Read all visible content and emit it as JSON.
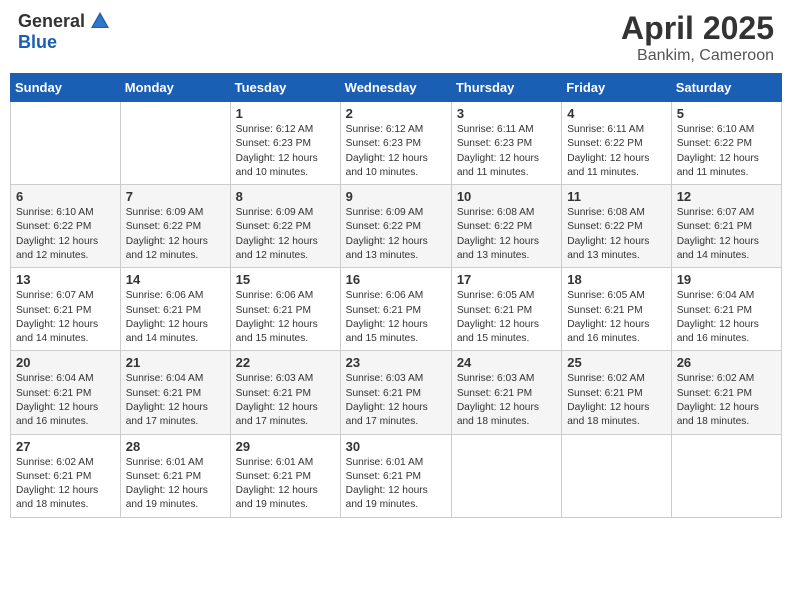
{
  "header": {
    "logo_general": "General",
    "logo_blue": "Blue",
    "month": "April 2025",
    "location": "Bankim, Cameroon"
  },
  "weekdays": [
    "Sunday",
    "Monday",
    "Tuesday",
    "Wednesday",
    "Thursday",
    "Friday",
    "Saturday"
  ],
  "weeks": [
    [
      {
        "day": "",
        "info": ""
      },
      {
        "day": "",
        "info": ""
      },
      {
        "day": "1",
        "info": "Sunrise: 6:12 AM\nSunset: 6:23 PM\nDaylight: 12 hours and 10 minutes."
      },
      {
        "day": "2",
        "info": "Sunrise: 6:12 AM\nSunset: 6:23 PM\nDaylight: 12 hours and 10 minutes."
      },
      {
        "day": "3",
        "info": "Sunrise: 6:11 AM\nSunset: 6:23 PM\nDaylight: 12 hours and 11 minutes."
      },
      {
        "day": "4",
        "info": "Sunrise: 6:11 AM\nSunset: 6:22 PM\nDaylight: 12 hours and 11 minutes."
      },
      {
        "day": "5",
        "info": "Sunrise: 6:10 AM\nSunset: 6:22 PM\nDaylight: 12 hours and 11 minutes."
      }
    ],
    [
      {
        "day": "6",
        "info": "Sunrise: 6:10 AM\nSunset: 6:22 PM\nDaylight: 12 hours and 12 minutes."
      },
      {
        "day": "7",
        "info": "Sunrise: 6:09 AM\nSunset: 6:22 PM\nDaylight: 12 hours and 12 minutes."
      },
      {
        "day": "8",
        "info": "Sunrise: 6:09 AM\nSunset: 6:22 PM\nDaylight: 12 hours and 12 minutes."
      },
      {
        "day": "9",
        "info": "Sunrise: 6:09 AM\nSunset: 6:22 PM\nDaylight: 12 hours and 13 minutes."
      },
      {
        "day": "10",
        "info": "Sunrise: 6:08 AM\nSunset: 6:22 PM\nDaylight: 12 hours and 13 minutes."
      },
      {
        "day": "11",
        "info": "Sunrise: 6:08 AM\nSunset: 6:22 PM\nDaylight: 12 hours and 13 minutes."
      },
      {
        "day": "12",
        "info": "Sunrise: 6:07 AM\nSunset: 6:21 PM\nDaylight: 12 hours and 14 minutes."
      }
    ],
    [
      {
        "day": "13",
        "info": "Sunrise: 6:07 AM\nSunset: 6:21 PM\nDaylight: 12 hours and 14 minutes."
      },
      {
        "day": "14",
        "info": "Sunrise: 6:06 AM\nSunset: 6:21 PM\nDaylight: 12 hours and 14 minutes."
      },
      {
        "day": "15",
        "info": "Sunrise: 6:06 AM\nSunset: 6:21 PM\nDaylight: 12 hours and 15 minutes."
      },
      {
        "day": "16",
        "info": "Sunrise: 6:06 AM\nSunset: 6:21 PM\nDaylight: 12 hours and 15 minutes."
      },
      {
        "day": "17",
        "info": "Sunrise: 6:05 AM\nSunset: 6:21 PM\nDaylight: 12 hours and 15 minutes."
      },
      {
        "day": "18",
        "info": "Sunrise: 6:05 AM\nSunset: 6:21 PM\nDaylight: 12 hours and 16 minutes."
      },
      {
        "day": "19",
        "info": "Sunrise: 6:04 AM\nSunset: 6:21 PM\nDaylight: 12 hours and 16 minutes."
      }
    ],
    [
      {
        "day": "20",
        "info": "Sunrise: 6:04 AM\nSunset: 6:21 PM\nDaylight: 12 hours and 16 minutes."
      },
      {
        "day": "21",
        "info": "Sunrise: 6:04 AM\nSunset: 6:21 PM\nDaylight: 12 hours and 17 minutes."
      },
      {
        "day": "22",
        "info": "Sunrise: 6:03 AM\nSunset: 6:21 PM\nDaylight: 12 hours and 17 minutes."
      },
      {
        "day": "23",
        "info": "Sunrise: 6:03 AM\nSunset: 6:21 PM\nDaylight: 12 hours and 17 minutes."
      },
      {
        "day": "24",
        "info": "Sunrise: 6:03 AM\nSunset: 6:21 PM\nDaylight: 12 hours and 18 minutes."
      },
      {
        "day": "25",
        "info": "Sunrise: 6:02 AM\nSunset: 6:21 PM\nDaylight: 12 hours and 18 minutes."
      },
      {
        "day": "26",
        "info": "Sunrise: 6:02 AM\nSunset: 6:21 PM\nDaylight: 12 hours and 18 minutes."
      }
    ],
    [
      {
        "day": "27",
        "info": "Sunrise: 6:02 AM\nSunset: 6:21 PM\nDaylight: 12 hours and 18 minutes."
      },
      {
        "day": "28",
        "info": "Sunrise: 6:01 AM\nSunset: 6:21 PM\nDaylight: 12 hours and 19 minutes."
      },
      {
        "day": "29",
        "info": "Sunrise: 6:01 AM\nSunset: 6:21 PM\nDaylight: 12 hours and 19 minutes."
      },
      {
        "day": "30",
        "info": "Sunrise: 6:01 AM\nSunset: 6:21 PM\nDaylight: 12 hours and 19 minutes."
      },
      {
        "day": "",
        "info": ""
      },
      {
        "day": "",
        "info": ""
      },
      {
        "day": "",
        "info": ""
      }
    ]
  ]
}
